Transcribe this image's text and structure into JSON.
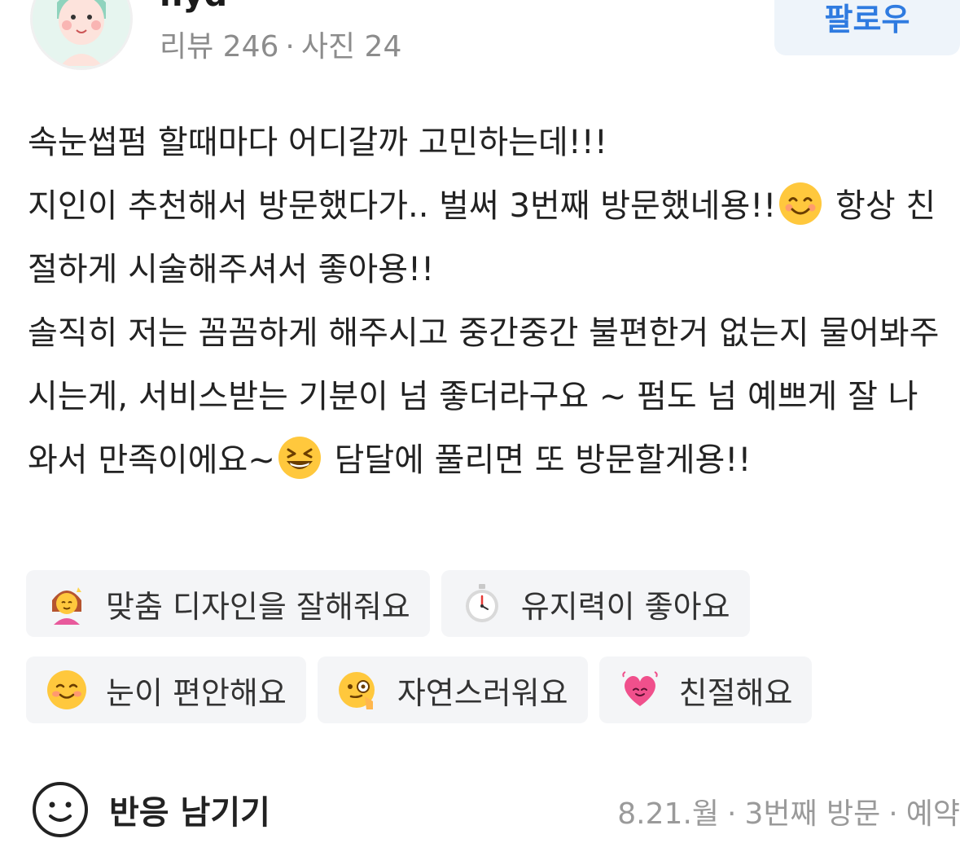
{
  "profile": {
    "username": "nyd",
    "reviews_label": "리뷰 246",
    "photos_label": "사진 24",
    "separator": "·",
    "follow_label": "팔로우",
    "avatar_icon": "avatar-character-icon"
  },
  "review": {
    "lines": [
      "속눈썹펌 할때마다 어디갈까 고민하는데!!!",
      "지인이 추천해서 방문했다가.. 벌써 3번째 방문했네용!!",
      "항상 친절하게 시술해주셔서 좋아용!!",
      "솔직히 저는 꼼꼼하게 해주시고 중간중간 불편한거 없는지 물어봐주시는게, 서비스받는 기분이 넘 좋더라구요 ~ 펌도 넘 예쁘게 잘 나와서 만족이에요~",
      "담달에 풀리면 또 방문할게용!!"
    ]
  },
  "tags": [
    {
      "icon": "woman-getting-haircut-icon",
      "label": "맞춤 디자인을 잘해줘요"
    },
    {
      "icon": "stopwatch-icon",
      "label": "유지력이 좋아요"
    },
    {
      "icon": "smiling-face-icon",
      "label": "눈이 편안해요"
    },
    {
      "icon": "face-with-monocle-icon",
      "label": "자연스러워요"
    },
    {
      "icon": "pink-heart-icon",
      "label": "친절해요"
    }
  ],
  "footer": {
    "react_label": "반응 남기기",
    "react_icon": "smiley-outline-icon",
    "date": "8.21.월",
    "visit": "3번째 방문",
    "method": "예약",
    "separator": "·"
  },
  "colors": {
    "accent_blue": "#2f7be0",
    "follow_bg": "#eef4fa",
    "tag_bg": "#f4f5f7",
    "meta_gray": "#8c8c8c"
  }
}
